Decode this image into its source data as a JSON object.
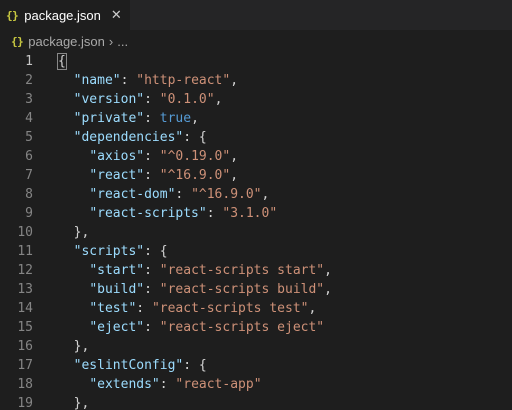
{
  "tab": {
    "icon": "{}",
    "title": "package.json",
    "close": "✕"
  },
  "breadcrumb": {
    "icon": "{}",
    "file": "package.json",
    "separator": "›",
    "more": "..."
  },
  "colors": {
    "background": "#1e1e1e",
    "key": "#9cdcfe",
    "string": "#ce9178",
    "boolean": "#569cd6",
    "punctuation": "#d4d4d4",
    "json_icon": "#cbcb41"
  },
  "lines": [
    {
      "n": "1",
      "tokens": [
        {
          "t": "p",
          "v": "{"
        }
      ]
    },
    {
      "n": "2",
      "tokens": [
        {
          "t": "p",
          "v": "  "
        },
        {
          "t": "k",
          "v": "\"name\""
        },
        {
          "t": "p",
          "v": ": "
        },
        {
          "t": "s",
          "v": "\"http-react\""
        },
        {
          "t": "p",
          "v": ","
        }
      ]
    },
    {
      "n": "3",
      "tokens": [
        {
          "t": "p",
          "v": "  "
        },
        {
          "t": "k",
          "v": "\"version\""
        },
        {
          "t": "p",
          "v": ": "
        },
        {
          "t": "s",
          "v": "\"0.1.0\""
        },
        {
          "t": "p",
          "v": ","
        }
      ]
    },
    {
      "n": "4",
      "tokens": [
        {
          "t": "p",
          "v": "  "
        },
        {
          "t": "k",
          "v": "\"private\""
        },
        {
          "t": "p",
          "v": ": "
        },
        {
          "t": "b",
          "v": "true"
        },
        {
          "t": "p",
          "v": ","
        }
      ]
    },
    {
      "n": "5",
      "tokens": [
        {
          "t": "p",
          "v": "  "
        },
        {
          "t": "k",
          "v": "\"dependencies\""
        },
        {
          "t": "p",
          "v": ": {"
        }
      ]
    },
    {
      "n": "6",
      "tokens": [
        {
          "t": "p",
          "v": "    "
        },
        {
          "t": "k",
          "v": "\"axios\""
        },
        {
          "t": "p",
          "v": ": "
        },
        {
          "t": "s",
          "v": "\"^0.19.0\""
        },
        {
          "t": "p",
          "v": ","
        }
      ]
    },
    {
      "n": "7",
      "tokens": [
        {
          "t": "p",
          "v": "    "
        },
        {
          "t": "k",
          "v": "\"react\""
        },
        {
          "t": "p",
          "v": ": "
        },
        {
          "t": "s",
          "v": "\"^16.9.0\""
        },
        {
          "t": "p",
          "v": ","
        }
      ]
    },
    {
      "n": "8",
      "tokens": [
        {
          "t": "p",
          "v": "    "
        },
        {
          "t": "k",
          "v": "\"react-dom\""
        },
        {
          "t": "p",
          "v": ": "
        },
        {
          "t": "s",
          "v": "\"^16.9.0\""
        },
        {
          "t": "p",
          "v": ","
        }
      ]
    },
    {
      "n": "9",
      "tokens": [
        {
          "t": "p",
          "v": "    "
        },
        {
          "t": "k",
          "v": "\"react-scripts\""
        },
        {
          "t": "p",
          "v": ": "
        },
        {
          "t": "s",
          "v": "\"3.1.0\""
        }
      ]
    },
    {
      "n": "10",
      "tokens": [
        {
          "t": "p",
          "v": "  },"
        }
      ]
    },
    {
      "n": "11",
      "tokens": [
        {
          "t": "p",
          "v": "  "
        },
        {
          "t": "k",
          "v": "\"scripts\""
        },
        {
          "t": "p",
          "v": ": {"
        }
      ]
    },
    {
      "n": "12",
      "tokens": [
        {
          "t": "p",
          "v": "    "
        },
        {
          "t": "k",
          "v": "\"start\""
        },
        {
          "t": "p",
          "v": ": "
        },
        {
          "t": "s",
          "v": "\"react-scripts start\""
        },
        {
          "t": "p",
          "v": ","
        }
      ]
    },
    {
      "n": "13",
      "tokens": [
        {
          "t": "p",
          "v": "    "
        },
        {
          "t": "k",
          "v": "\"build\""
        },
        {
          "t": "p",
          "v": ": "
        },
        {
          "t": "s",
          "v": "\"react-scripts build\""
        },
        {
          "t": "p",
          "v": ","
        }
      ]
    },
    {
      "n": "14",
      "tokens": [
        {
          "t": "p",
          "v": "    "
        },
        {
          "t": "k",
          "v": "\"test\""
        },
        {
          "t": "p",
          "v": ": "
        },
        {
          "t": "s",
          "v": "\"react-scripts test\""
        },
        {
          "t": "p",
          "v": ","
        }
      ]
    },
    {
      "n": "15",
      "tokens": [
        {
          "t": "p",
          "v": "    "
        },
        {
          "t": "k",
          "v": "\"eject\""
        },
        {
          "t": "p",
          "v": ": "
        },
        {
          "t": "s",
          "v": "\"react-scripts eject\""
        }
      ]
    },
    {
      "n": "16",
      "tokens": [
        {
          "t": "p",
          "v": "  },"
        }
      ]
    },
    {
      "n": "17",
      "tokens": [
        {
          "t": "p",
          "v": "  "
        },
        {
          "t": "k",
          "v": "\"eslintConfig\""
        },
        {
          "t": "p",
          "v": ": {"
        }
      ]
    },
    {
      "n": "18",
      "tokens": [
        {
          "t": "p",
          "v": "    "
        },
        {
          "t": "k",
          "v": "\"extends\""
        },
        {
          "t": "p",
          "v": ": "
        },
        {
          "t": "s",
          "v": "\"react-app\""
        }
      ]
    },
    {
      "n": "19",
      "tokens": [
        {
          "t": "p",
          "v": "  },"
        }
      ]
    }
  ]
}
